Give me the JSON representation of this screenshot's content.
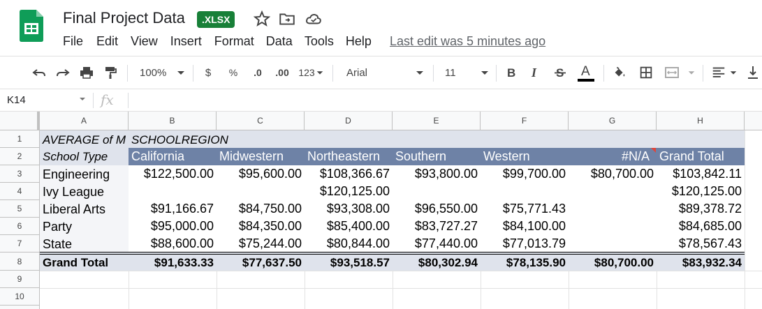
{
  "header": {
    "title": "Final Project Data",
    "badge": ".XLSX",
    "menu": [
      "File",
      "Edit",
      "View",
      "Insert",
      "Format",
      "Data",
      "Tools",
      "Help"
    ],
    "last_edit": "Last edit was 5 minutes ago"
  },
  "toolbar": {
    "zoom": "100%",
    "currency": "$",
    "percent": "%",
    "dec_decrease": ".0",
    "dec_increase": ".00",
    "more_formats": "123",
    "font": "Arial",
    "font_size": "11"
  },
  "formula_bar": {
    "cell_ref": "K14",
    "fx": "fx"
  },
  "grid": {
    "columns": [
      "A",
      "B",
      "C",
      "D",
      "E",
      "F",
      "G",
      "H"
    ],
    "rows": [
      "1",
      "2",
      "3",
      "4",
      "5",
      "6",
      "7",
      "8",
      "9",
      "10"
    ],
    "pivot_title": "AVERAGE of M",
    "pivot_col_field": "SCHOOLREGION",
    "row_field": "School Type",
    "col_headers": [
      "California",
      "Midwestern",
      "Northeastern",
      "Southern",
      "Western",
      "#N/A",
      "Grand Total"
    ],
    "data_rows": [
      {
        "label": "Engineering",
        "values": [
          "$122,500.00",
          "$95,600.00",
          "$108,366.67",
          "$93,800.00",
          "$99,700.00",
          "$80,700.00",
          "$103,842.11"
        ]
      },
      {
        "label": "Ivy League",
        "values": [
          "",
          "",
          "$120,125.00",
          "",
          "",
          "",
          "$120,125.00"
        ]
      },
      {
        "label": "Liberal Arts",
        "values": [
          "$91,166.67",
          "$84,750.00",
          "$93,308.00",
          "$96,550.00",
          "$75,771.43",
          "",
          "$89,378.72"
        ]
      },
      {
        "label": "Party",
        "values": [
          "$95,000.00",
          "$84,350.00",
          "$85,400.00",
          "$83,727.27",
          "$84,100.00",
          "",
          "$84,685.00"
        ]
      },
      {
        "label": "State",
        "values": [
          "$88,600.00",
          "$75,244.00",
          "$80,844.00",
          "$77,440.00",
          "$77,013.79",
          "",
          "$78,567.43"
        ]
      }
    ],
    "grand_total": {
      "label": "Grand Total",
      "values": [
        "$91,633.33",
        "$77,637.50",
        "$93,518.57",
        "$80,302.94",
        "$78,135.90",
        "$80,700.00",
        "$83,932.34"
      ]
    }
  },
  "colors": {
    "pivot_header_bg": "#6e82a6",
    "pivot_light_bg": "#dfe3ec",
    "sheets_green": "#0f9d58",
    "badge_green": "#188038"
  }
}
